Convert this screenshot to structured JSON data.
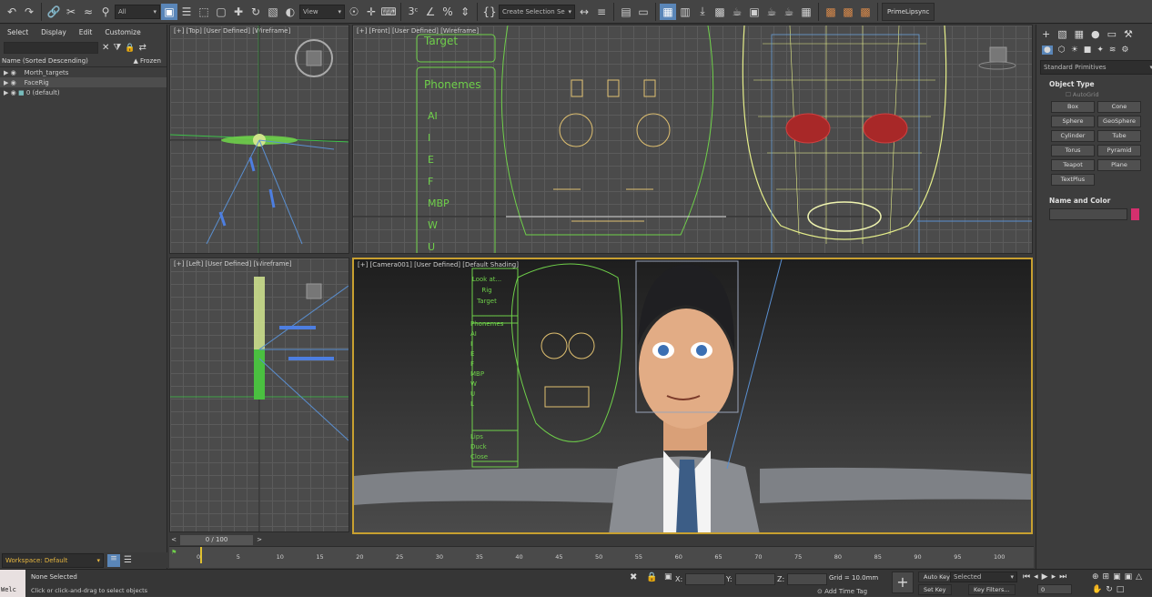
{
  "toolbar": {
    "selection_filter": "All",
    "ref_coord": "View",
    "selection_set": "Create Selection Se",
    "plugin": "PrimeLipsync"
  },
  "scene_explorer": {
    "menu": [
      "Select",
      "Display",
      "Edit",
      "Customize"
    ],
    "column_name": "Name (Sorted Descending)",
    "column_frozen": "▲ Frozen",
    "items": [
      "Morth_targets",
      "FaceRig",
      "0 (default)"
    ]
  },
  "viewports": {
    "top": "[+] [Top] [User Defined] [Wireframe]",
    "front": "[+] [Front] [User Defined] [Wireframe]",
    "left": "[+] [Left] [User Defined] [Wireframe]",
    "camera": "[+] [Camera001] [User Defined] [Default Shading]"
  },
  "rig_panel": {
    "target": "Target",
    "phonemes": "Phonemes",
    "phoneme_list": [
      "AI",
      "I",
      "E",
      "F",
      "MBP",
      "W",
      "U",
      "L"
    ],
    "look_at": "Look at...",
    "rig": "Rig",
    "target_small": "Target",
    "lips": "Lips",
    "duck": "Duck",
    "close": "Close"
  },
  "command_panel": {
    "dropdown": "Standard Primitives",
    "object_type": "Object Type",
    "autogrid": "AutoGrid",
    "buttons": [
      "Box",
      "Cone",
      "Sphere",
      "GeoSphere",
      "Cylinder",
      "Tube",
      "Torus",
      "Pyramid",
      "Teapot",
      "Plane",
      "TextPlus"
    ],
    "name_and_color": "Name and Color",
    "color": "#d4306e"
  },
  "timeline": {
    "frame": "0 / 100",
    "ticks": [
      "0",
      "5",
      "10",
      "15",
      "20",
      "25",
      "30",
      "35",
      "40",
      "45",
      "50",
      "55",
      "60",
      "65",
      "70",
      "75",
      "80",
      "85",
      "90",
      "95",
      "100"
    ]
  },
  "workspace": "Workspace: Default",
  "status": {
    "maxscript": "Welc",
    "selection": "None Selected",
    "hint": "Click or click-and-drag to select objects",
    "x_label": "X:",
    "y_label": "Y:",
    "z_label": "Z:",
    "grid": "Grid = 10.0mm",
    "add_time_tag": "Add Time Tag",
    "auto_key": "Auto Key",
    "selected": "Selected",
    "set_key": "Set Key",
    "key_filters": "Key Filters...",
    "frame_value": "0"
  }
}
